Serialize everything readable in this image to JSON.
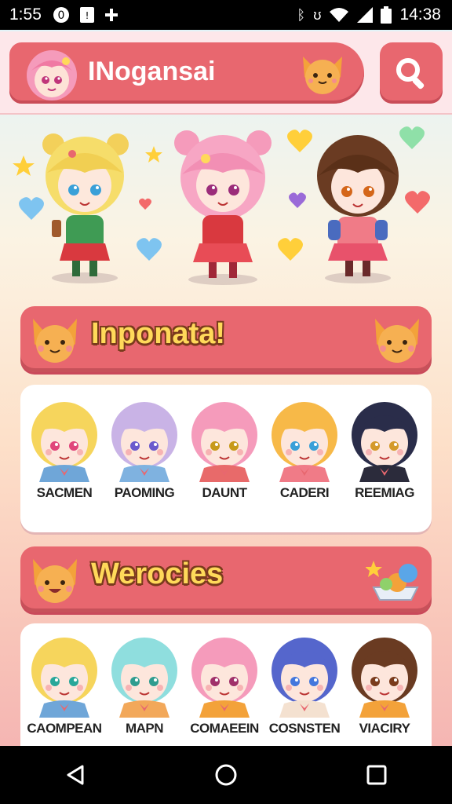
{
  "status_bar": {
    "time": "1:55",
    "clock": "14:38",
    "left_icons": [
      "notification-icon",
      "sim-icon",
      "plus-icon"
    ],
    "right_icons": [
      "bluetooth-icon",
      "vibrate-icon",
      "wifi-icon",
      "signal-icon",
      "battery-icon"
    ]
  },
  "header": {
    "title": "INogansai",
    "search_icon": "search-icon"
  },
  "hero": {
    "characters": [
      "blonde-bear-girl",
      "pink-bear-girl",
      "brown-hair-girl"
    ]
  },
  "section1": {
    "title": "Inponata!",
    "characters": [
      {
        "name": "SACMEN",
        "hair": "#f6d55c",
        "eyes": "#e0457b",
        "outfit": "#6fa6d8"
      },
      {
        "name": "PAOMING",
        "hair": "#c9b3e6",
        "eyes": "#6a5acd",
        "outfit": "#7fb2e0"
      },
      {
        "name": "DAUNT",
        "hair": "#f59bbb",
        "eyes": "#c79a1a",
        "outfit": "#e86a6a"
      },
      {
        "name": "CADERI",
        "hair": "#f7b948",
        "eyes": "#3aa0d8",
        "outfit": "#f07b87"
      },
      {
        "name": "REEMIAG",
        "hair": "#2a2d4a",
        "eyes": "#d49a2a",
        "outfit": "#2b2b3b"
      }
    ]
  },
  "section2": {
    "title": "Werocies",
    "characters": [
      {
        "name": "CAOMPEAN",
        "hair": "#f6d55c",
        "eyes": "#28a79a",
        "outfit": "#6fa6d8"
      },
      {
        "name": "MAPN",
        "hair": "#8fdede",
        "eyes": "#2f9c8f",
        "outfit": "#f2a85a"
      },
      {
        "name": "COMAEEIN",
        "hair": "#f59bbb",
        "eyes": "#a0306a",
        "outfit": "#f3a23a"
      },
      {
        "name": "COSNSTEN",
        "hair": "#5566cc",
        "eyes": "#4477dd",
        "outfit": "#f4e1d0"
      },
      {
        "name": "VIACIRY",
        "hair": "#6a3b22",
        "eyes": "#7a3b1c",
        "outfit": "#f3a23a"
      }
    ]
  },
  "colors": {
    "accent": "#e8676f",
    "banner_text": "#ffd95a"
  },
  "navbar": {
    "buttons": [
      "back-icon",
      "home-icon",
      "recents-icon"
    ]
  }
}
